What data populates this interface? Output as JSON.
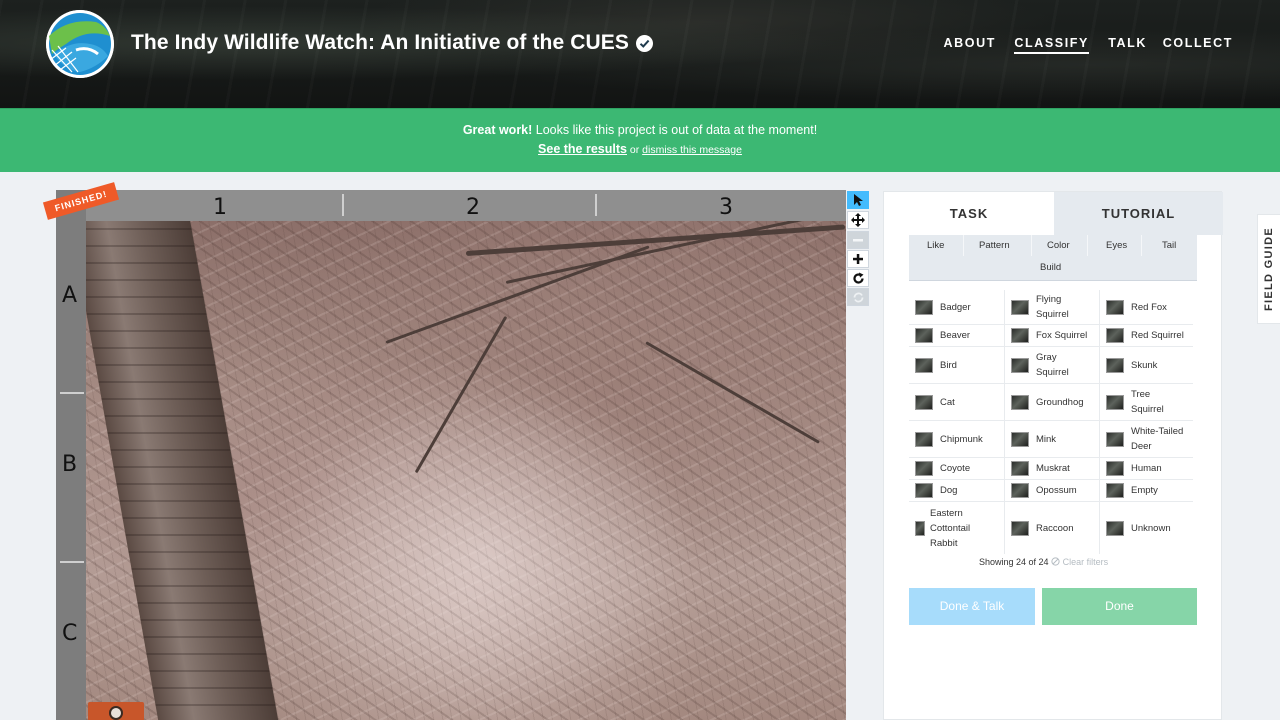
{
  "header": {
    "project_title": "The Indy Wildlife Watch: An Initiative of the CUES",
    "nav": [
      {
        "label": "ABOUT",
        "active": false
      },
      {
        "label": "CLASSIFY",
        "active": true
      },
      {
        "label": "TALK",
        "active": false
      },
      {
        "label": "COLLECT",
        "active": false
      }
    ]
  },
  "banner": {
    "bold_text": "Great work!",
    "message": " Looks like this project is out of data at the moment!",
    "results_link": "See the results",
    "or_text": " or ",
    "dismiss_link": "dismiss this message"
  },
  "subject_viewer": {
    "finished_label": "FINISHED!",
    "columns": [
      "1",
      "2",
      "3"
    ],
    "rows": [
      "A",
      "B",
      "C"
    ],
    "tools": [
      "pointer-icon",
      "move-icon",
      "zoom-out-icon",
      "zoom-in-icon",
      "rotate-icon",
      "reset-icon"
    ]
  },
  "task_panel": {
    "tabs": [
      "TASK",
      "TUTORIAL"
    ],
    "filters": [
      "Like",
      "Pattern",
      "Color",
      "Eyes",
      "Tail",
      "Build"
    ],
    "choices": [
      "Badger",
      "Flying Squirrel",
      "Red Fox",
      "Beaver",
      "Fox Squirrel",
      "Red Squirrel",
      "Bird",
      "Gray Squirrel",
      "Skunk",
      "Cat",
      "Groundhog",
      "Tree Squirrel",
      "Chipmunk",
      "Mink",
      "White-Tailed Deer",
      "Coyote",
      "Muskrat",
      "Human",
      "Dog",
      "Opossum",
      "Empty",
      "Eastern Cottontail Rabbit",
      "Raccoon",
      "Unknown"
    ],
    "showing_text": "Showing 24 of 24",
    "clear_filters": "Clear filters",
    "done_talk_label": "Done & Talk",
    "done_label": "Done"
  },
  "field_guide_label": "FIELD GUIDE",
  "colors": {
    "banner_green": "#3cb873",
    "active_tool_blue": "#43bbfd",
    "finished_orange": "#ef5a28",
    "done_talk_blue": "#a7dcfb",
    "done_green": "#86d5a8"
  }
}
